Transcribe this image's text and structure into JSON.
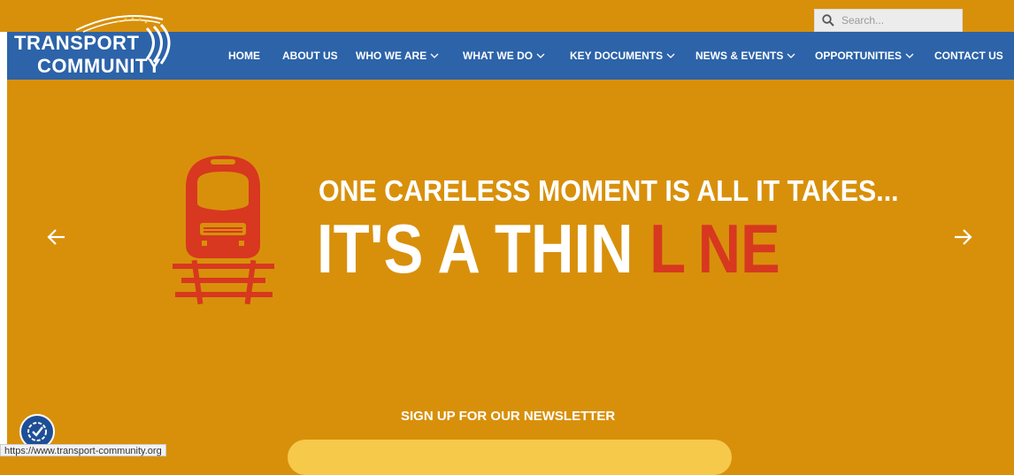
{
  "search": {
    "placeholder": "Search..."
  },
  "logo": {
    "line1": "TRANSPORT",
    "line2": "COMMUNITY"
  },
  "nav": [
    {
      "label": "HOME",
      "has_dropdown": false
    },
    {
      "label": "ABOUT US",
      "has_dropdown": false
    },
    {
      "label": "WHO WE ARE",
      "has_dropdown": true
    },
    {
      "label": "WHAT WE DO",
      "has_dropdown": true
    },
    {
      "label": "KEY DOCUMENTS",
      "has_dropdown": true
    },
    {
      "label": "NEWS & EVENTS",
      "has_dropdown": true
    },
    {
      "label": "OPPORTUNITIES",
      "has_dropdown": true
    },
    {
      "label": "CONTACT US",
      "has_dropdown": false
    }
  ],
  "hero": {
    "line1": "ONE CARELESS MOMENT IS ALL IT TAKES...",
    "line2_white": "IT'S A THIN ",
    "line2_red": "L NE"
  },
  "newsletter": {
    "heading": "SIGN UP FOR OUR NEWSLETTER"
  },
  "status_url": "https://www.transport-community.org",
  "colors": {
    "background": "#d8900b",
    "nav": "#2c63a9",
    "accent_red": "#d7381f",
    "newsletter_field": "#f6c94b"
  }
}
